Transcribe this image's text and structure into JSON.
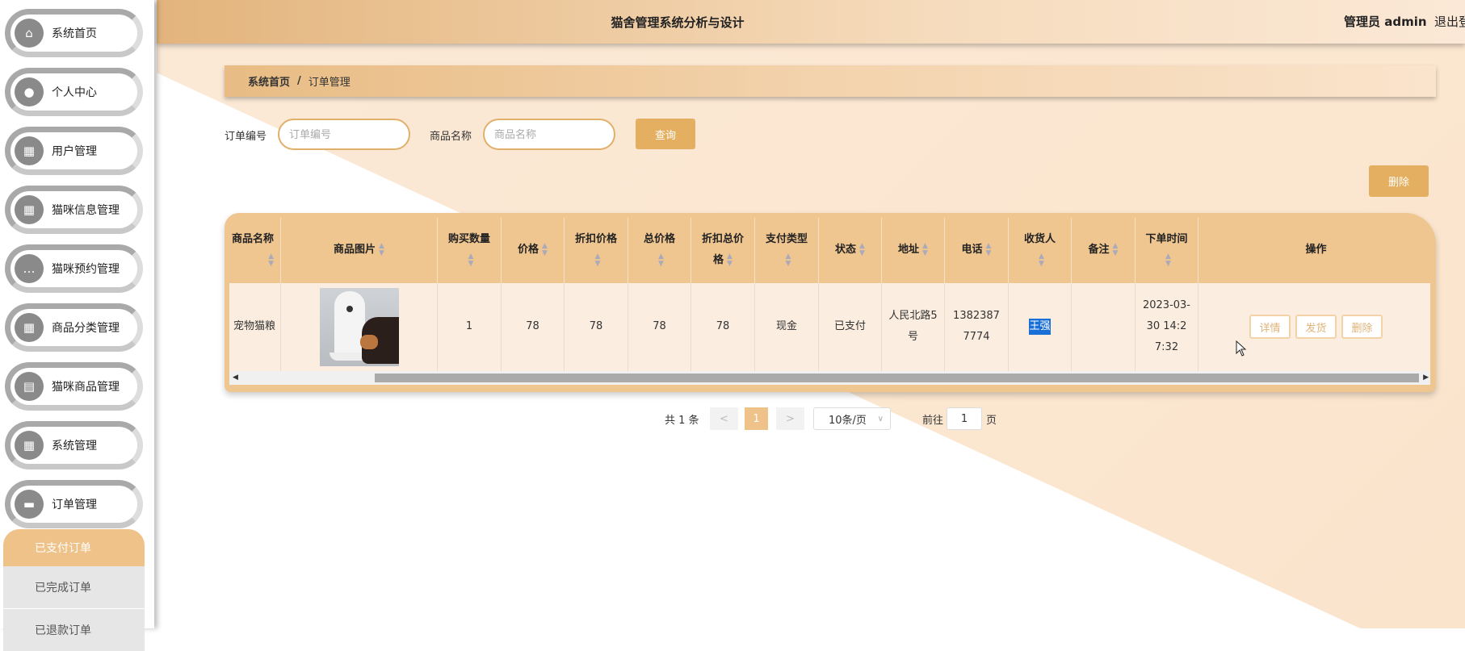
{
  "sidebar": {
    "items": [
      {
        "label": "系统首页",
        "icon": "home-icon"
      },
      {
        "label": "个人中心",
        "icon": "user-icon"
      },
      {
        "label": "用户管理",
        "icon": "grid-icon"
      },
      {
        "label": "猫咪信息管理",
        "icon": "grid-icon"
      },
      {
        "label": "猫咪预约管理",
        "icon": "chat-icon"
      },
      {
        "label": "商品分类管理",
        "icon": "grid-icon"
      },
      {
        "label": "猫咪商品管理",
        "icon": "clipboard-icon"
      },
      {
        "label": "系统管理",
        "icon": "grid-icon"
      },
      {
        "label": "订单管理",
        "icon": "monitor-icon"
      }
    ],
    "submenu": [
      "已支付订单",
      "已完成订单",
      "已退款订单"
    ]
  },
  "header": {
    "title": "猫舍管理系统分析与设计",
    "user": "管理员 admin",
    "logout": "退出登录"
  },
  "breadcrumb": {
    "home": "系统首页",
    "sep": "/",
    "current": "订单管理"
  },
  "search": {
    "order_no_label": "订单编号",
    "order_no_placeholder": "订单编号",
    "order_no_value": "",
    "product_label": "商品名称",
    "product_placeholder": "商品名称",
    "product_value": "",
    "query": "查询"
  },
  "toolbar": {
    "delete": "删除"
  },
  "table": {
    "headers": [
      "商品名称",
      "商品图片",
      "购买数量",
      "价格",
      "折扣价格",
      "总价格",
      "折扣总价格",
      "支付类型",
      "状态",
      "地址",
      "电话",
      "收货人",
      "备注",
      "下单时间",
      "操作"
    ],
    "rows": [
      {
        "cells": [
          "宠物猫粮",
          "",
          "1",
          "78",
          "78",
          "78",
          "78",
          "现金",
          "已支付",
          "人民北路5号",
          "13823877774",
          "王强",
          "",
          "2023-03-30 14:27:32"
        ]
      }
    ],
    "actions": [
      "详情",
      "发货",
      "删除"
    ]
  },
  "pagination": {
    "total": "共 1 条",
    "prev": "<",
    "page": "1",
    "next": ">",
    "page_size": "10条/页",
    "goto": "前往",
    "goto_value": "1",
    "page_unit": "页"
  },
  "colors": {
    "accent": "#e4af60",
    "header_bg": "#efc590",
    "active_menu": "#efc28a"
  }
}
